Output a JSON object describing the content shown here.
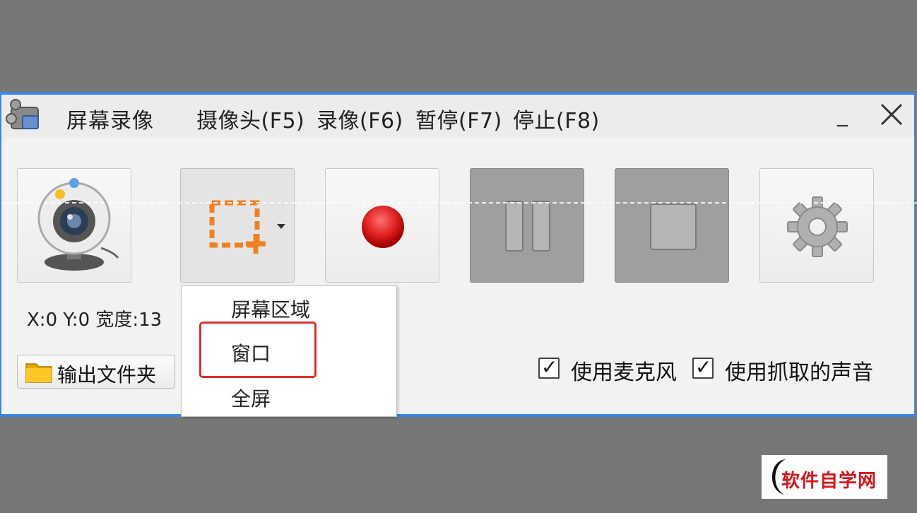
{
  "window": {
    "title": "屏幕录像",
    "menu": [
      "摄像头(F5)",
      "录像(F6)",
      "暂停(F7)",
      "停止(F8)"
    ],
    "minimize_glyph": "_"
  },
  "toolbar": {
    "buttons": [
      {
        "name": "webcam",
        "icon": "webcam-icon",
        "state": "normal"
      },
      {
        "name": "region-select",
        "icon": "region-select-icon",
        "state": "pressed",
        "has_dropdown": true
      },
      {
        "name": "record",
        "icon": "record-icon",
        "state": "normal"
      },
      {
        "name": "pause",
        "icon": "pause-icon",
        "state": "disabled"
      },
      {
        "name": "stop",
        "icon": "stop-icon",
        "state": "disabled"
      },
      {
        "name": "settings",
        "icon": "gear-icon",
        "state": "normal"
      }
    ]
  },
  "status": {
    "coords_text": "X:0 Y:0 宽度:13"
  },
  "output_folder": {
    "label": "输出文件夹",
    "icon": "folder-icon"
  },
  "dropdown": {
    "items": [
      "屏幕区域",
      "窗口",
      "全屏"
    ],
    "highlighted": "窗口"
  },
  "options": {
    "use_mic": {
      "label": "使用麦克风",
      "checked": true
    },
    "use_captured_audio": {
      "label": "使用抓取的声音",
      "checked": true
    },
    "check_glyph": "✓"
  },
  "watermark": {
    "text": "软件自学网"
  },
  "colors": {
    "accent_border": "#3a86e8",
    "record_red": "#e02020",
    "region_orange": "#f08020",
    "highlight_red": "#e03030",
    "backdrop": "#777777"
  }
}
